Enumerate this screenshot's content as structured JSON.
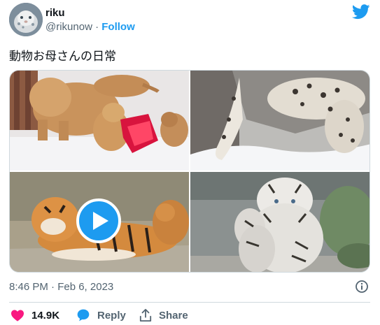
{
  "author": {
    "display_name": "riku",
    "handle": "@rikunow",
    "separator": "·",
    "follow_label": "Follow"
  },
  "tweet": {
    "text": "動物お母さんの日常",
    "timestamp": "8:46 PM · Feb 6, 2023"
  },
  "media": [
    {
      "name": "photo-lions-in-snow",
      "has_play_button": false
    },
    {
      "name": "photo-snow-leopard",
      "has_play_button": false
    },
    {
      "name": "video-tigers",
      "has_play_button": true
    },
    {
      "name": "photo-white-tiger-carrying-cub",
      "has_play_button": false
    }
  ],
  "actions": {
    "likes_count": "14.9K",
    "reply_label": "Reply",
    "share_label": "Share"
  },
  "colors": {
    "accent": "#1d9bf0",
    "like": "#f91880",
    "text_secondary": "#536471",
    "border": "#cfd9de"
  },
  "icons": [
    "twitter-bird-icon",
    "play-icon",
    "info-icon",
    "heart-icon",
    "reply-bubble-icon",
    "share-icon"
  ]
}
